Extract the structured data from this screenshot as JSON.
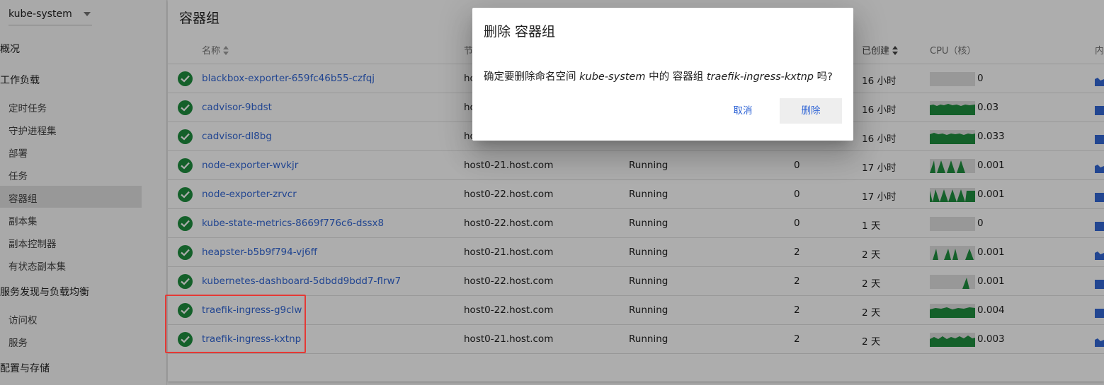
{
  "sidebar": {
    "namespace": "kube-system",
    "overview": "概况",
    "workloads": "工作负载",
    "workload_items": [
      "定时任务",
      "守护进程集",
      "部署",
      "任务",
      "容器组",
      "副本集",
      "副本控制器",
      "有状态副本集"
    ],
    "discovery": "服务发现与负载均衡",
    "discovery_items": [
      "访问权",
      "服务"
    ],
    "config": "配置与存储"
  },
  "main": {
    "title": "容器组",
    "columns": {
      "name": "名称",
      "node": "节",
      "age": "已创建",
      "cpu": "CPU（核）",
      "memory": "内"
    },
    "rows": [
      {
        "name": "blackbox-exporter-659fc46b55-czfqj",
        "node": "hc",
        "status": "",
        "restarts": "",
        "age": "16 小时",
        "cpu": "0"
      },
      {
        "name": "cadvisor-9bdst",
        "node": "hc",
        "status": "",
        "restarts": "",
        "age": "16 小时",
        "cpu": "0.03"
      },
      {
        "name": "cadvisor-dl8bg",
        "node": "hc",
        "status": "",
        "restarts": "",
        "age": "16 小时",
        "cpu": "0.033"
      },
      {
        "name": "node-exporter-wvkjr",
        "node": "host0-21.host.com",
        "status": "Running",
        "restarts": "0",
        "age": "17 小时",
        "cpu": "0.001"
      },
      {
        "name": "node-exporter-zrvcr",
        "node": "host0-22.host.com",
        "status": "Running",
        "restarts": "0",
        "age": "17 小时",
        "cpu": "0.001"
      },
      {
        "name": "kube-state-metrics-8669f776c6-dssx8",
        "node": "host0-22.host.com",
        "status": "Running",
        "restarts": "0",
        "age": "1 天",
        "cpu": "0"
      },
      {
        "name": "heapster-b5b9f794-vj6ff",
        "node": "host0-21.host.com",
        "status": "Running",
        "restarts": "2",
        "age": "2 天",
        "cpu": "0.001"
      },
      {
        "name": "kubernetes-dashboard-5dbdd9bdd7-flrw7",
        "node": "host0-22.host.com",
        "status": "Running",
        "restarts": "2",
        "age": "2 天",
        "cpu": "0.001"
      },
      {
        "name": "traefik-ingress-g9clw",
        "node": "host0-22.host.com",
        "status": "Running",
        "restarts": "2",
        "age": "2 天",
        "cpu": "0.004"
      },
      {
        "name": "traefik-ingress-kxtnp",
        "node": "host0-21.host.com",
        "status": "Running",
        "restarts": "2",
        "age": "2 天",
        "cpu": "0.003"
      }
    ]
  },
  "dialog": {
    "title": "删除 容器组",
    "msg_pre": "确定要删除命名空间 ",
    "msg_ns": "kube-system",
    "msg_mid": " 中的 容器组 ",
    "msg_pod": "traefik-ingress-kxtnp",
    "msg_post": " 吗?",
    "cancel": "取消",
    "delete": "删除"
  },
  "colors": {
    "accent": "#3367d6",
    "ok": "#1e8e3e",
    "spark": "#1e8e3e",
    "highlight": "#e53935"
  }
}
